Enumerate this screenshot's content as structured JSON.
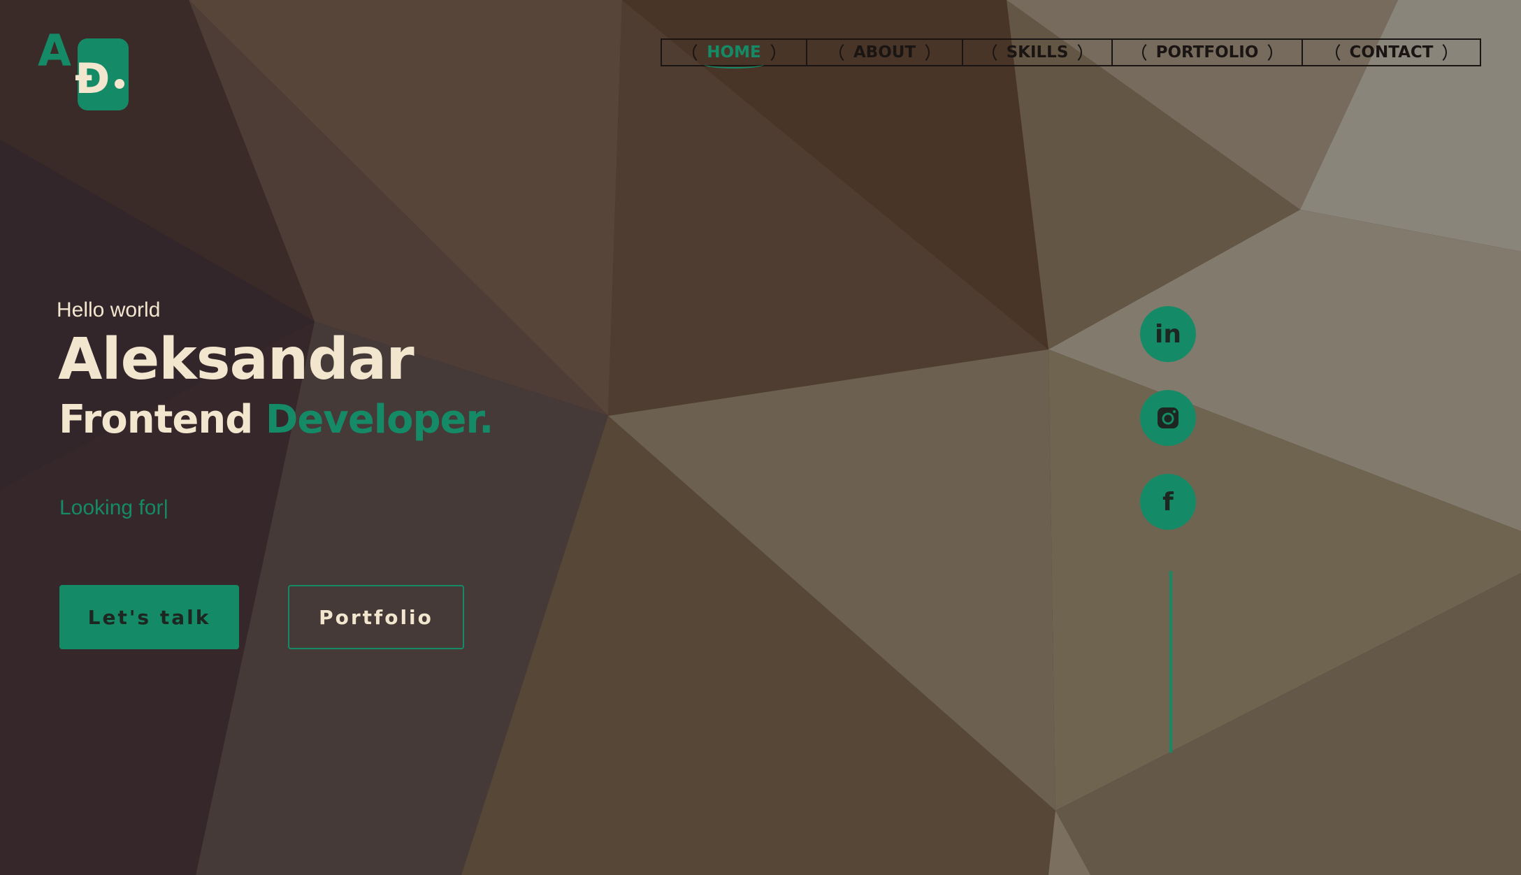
{
  "logo": {
    "letter_a": "A",
    "letter_d": "Đ"
  },
  "nav": {
    "items": [
      {
        "label": "HOME",
        "active": true
      },
      {
        "label": "ABOUT",
        "active": false
      },
      {
        "label": "SKILLS",
        "active": false
      },
      {
        "label": "PORTFOLIO",
        "active": false
      },
      {
        "label": "CONTACT",
        "active": false
      }
    ]
  },
  "hero": {
    "greeting": "Hello world",
    "name": "Aleksandar",
    "role_main": "Frontend",
    "role_accent": "Developer.",
    "typing": "Looking for|"
  },
  "buttons": {
    "talk": "Let's talk",
    "portfolio": "Portfolio"
  },
  "social": {
    "linkedin": "in",
    "instagram_icon": "instagram-icon",
    "facebook": "f"
  },
  "colors": {
    "accent": "#148b66",
    "cream": "#f3e6cf",
    "dark": "#1e2621"
  }
}
